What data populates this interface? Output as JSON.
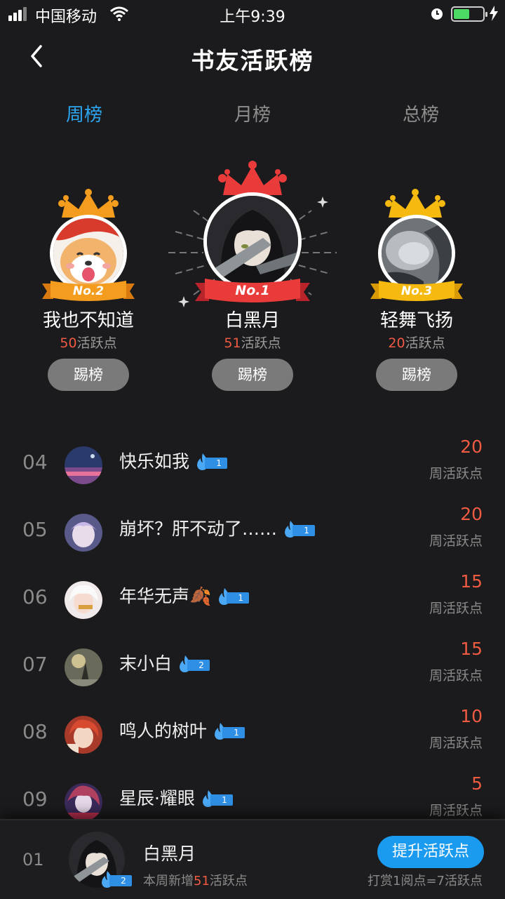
{
  "status_bar": {
    "carrier": "中国移动",
    "time": "上午9:39"
  },
  "header": {
    "title": "书友活跃榜"
  },
  "tabs": [
    {
      "label": "周榜",
      "active": true
    },
    {
      "label": "月榜",
      "active": false
    },
    {
      "label": "总榜",
      "active": false
    }
  ],
  "podium": [
    {
      "rank_label": "No.1",
      "name": "白黑月",
      "score": "51",
      "unit": "活跃点",
      "button": "踢榜"
    },
    {
      "rank_label": "No.2",
      "name": "我也不知道",
      "score": "50",
      "unit": "活跃点",
      "button": "踢榜"
    },
    {
      "rank_label": "No.3",
      "name": "轻舞飞扬",
      "score": "20",
      "unit": "活跃点",
      "button": "踢榜"
    }
  ],
  "list": [
    {
      "rank": "04",
      "name": "快乐如我",
      "level": "1",
      "score": "20",
      "unit": "周活跃点"
    },
    {
      "rank": "05",
      "name": "崩坏？肝不动了……",
      "level": "1",
      "score": "20",
      "unit": "周活跃点"
    },
    {
      "rank": "06",
      "name": "年华无声🍂",
      "level": "1",
      "score": "15",
      "unit": "周活跃点"
    },
    {
      "rank": "07",
      "name": "末小白",
      "level": "2",
      "score": "15",
      "unit": "周活跃点"
    },
    {
      "rank": "08",
      "name": "鸣人的树叶",
      "level": "1",
      "score": "10",
      "unit": "周活跃点"
    },
    {
      "rank": "09",
      "name": "星辰·耀眼",
      "level": "1",
      "score": "5",
      "unit": "周活跃点"
    }
  ],
  "my_rank": {
    "rank": "01",
    "name": "白黑月",
    "level": "2",
    "sub_prefix": "本周新增",
    "sub_value": "51",
    "sub_suffix": "活跃点",
    "button": "提升活跃点",
    "hint": "打赏1阅点=7活跃点"
  },
  "colors": {
    "accent": "#2ca6f0",
    "score": "#ef5a43",
    "crown_red": "#ea3b3b",
    "crown_orange": "#f39c1d",
    "crown_gold": "#f5b90f",
    "background": "#1b1b1d"
  }
}
